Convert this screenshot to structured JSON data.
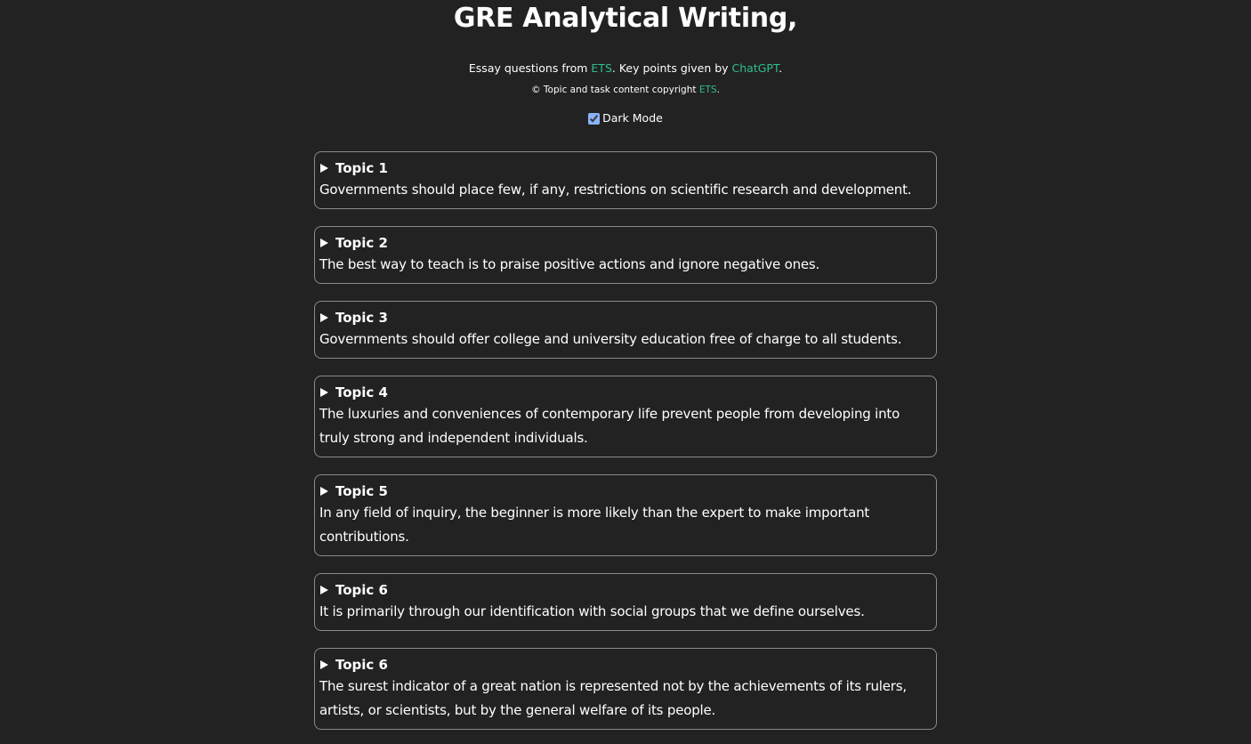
{
  "header": {
    "title": "GRE Analytical Writing,",
    "credits": {
      "prefix": "Essay questions from ",
      "source_link": "ETS",
      "middle": ". Key points given by ",
      "ai_link": "ChatGPT",
      "suffix": "."
    },
    "copyright": {
      "prefix": "© Topic and task content copyright ",
      "link": "ETS",
      "suffix": "."
    },
    "dark_mode": {
      "label": "Dark Mode",
      "checked": true
    }
  },
  "colors": {
    "background": "#222222",
    "text": "#ffffff",
    "link": "#2fbf8f",
    "border": "#8a8a8a"
  },
  "topics": [
    {
      "title": "Topic 1",
      "text": "Governments should place few, if any, restrictions on scientific research and development."
    },
    {
      "title": "Topic 2",
      "text": "The best way to teach is to praise positive actions and ignore negative ones."
    },
    {
      "title": "Topic 3",
      "text": "Governments should offer college and university education free of charge to all students."
    },
    {
      "title": "Topic 4",
      "text": "The luxuries and conveniences of contemporary life prevent people from developing into truly strong and independent individuals."
    },
    {
      "title": "Topic 5",
      "text": "In any field of inquiry, the beginner is more likely than the expert to make important contributions."
    },
    {
      "title": "Topic 6",
      "text": "It is primarily through our identification with social groups that we define ourselves."
    },
    {
      "title": "Topic 6",
      "text": "The surest indicator of a great nation is represented not by the achievements of its rulers, artists, or scientists, but by the general welfare of its people."
    }
  ]
}
